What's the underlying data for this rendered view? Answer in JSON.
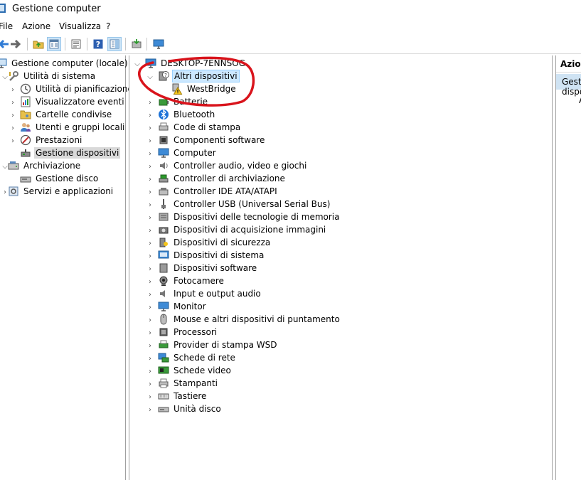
{
  "window": {
    "title": "Gestione computer"
  },
  "menu": {
    "file": "File",
    "action": "Azione",
    "view": "Visualizza",
    "help": "?"
  },
  "left_tree": {
    "root": "Gestione computer (locale)",
    "system_tools": "Utilità di sistema",
    "task_scheduler": "Utilità di pianificazione",
    "event_viewer": "Visualizzatore eventi",
    "shared_folders": "Cartelle condivise",
    "local_users": "Utenti e gruppi locali",
    "performance": "Prestazioni",
    "device_manager": "Gestione dispositivi",
    "storage": "Archiviazione",
    "disk_management": "Gestione disco",
    "services": "Servizi e applicazioni"
  },
  "device_tree": {
    "computer_name": "DESKTOP-7ENNSOG",
    "other_devices": "Altri dispositivi",
    "westbridge": "WestBridge",
    "categories": [
      "Batterie",
      "Bluetooth",
      "Code di stampa",
      "Componenti software",
      "Computer",
      "Controller audio, video e giochi",
      "Controller di archiviazione",
      "Controller IDE ATA/ATAPI",
      "Controller USB (Universal Serial Bus)",
      "Dispositivi delle tecnologie di memoria",
      "Dispositivi di acquisizione immagini",
      "Dispositivi di sicurezza",
      "Dispositivi di sistema",
      "Dispositivi software",
      "Fotocamere",
      "Input e output audio",
      "Monitor",
      "Mouse e altri dispositivi di puntamento",
      "Processori",
      "Provider di stampa WSD",
      "Schede di rete",
      "Schede video",
      "Stampanti",
      "Tastiere",
      "Unità disco"
    ]
  },
  "actions_pane": {
    "header": "Azioni",
    "selected": "Gestione dispositivi",
    "sub": "A"
  },
  "colors": {
    "selection_blue": "#cce8ff",
    "selection_gray": "#d9d9d9",
    "annotation_red": "#d9141c"
  }
}
